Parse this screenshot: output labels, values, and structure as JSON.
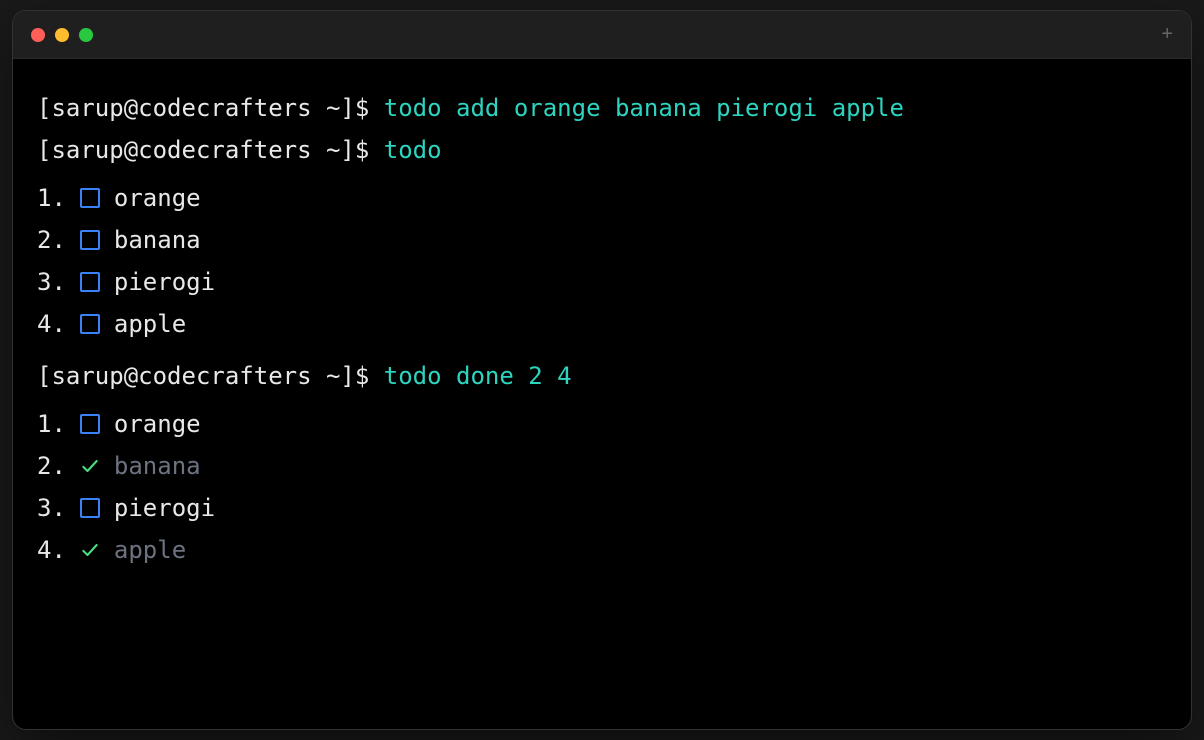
{
  "prompt": "[sarup@codecrafters ~]$ ",
  "commands": {
    "cmd1": "todo add orange banana pierogi apple",
    "cmd2": "todo",
    "cmd3": "todo done 2 4"
  },
  "list1": [
    {
      "num": "1.",
      "text": "orange",
      "done": false
    },
    {
      "num": "2.",
      "text": "banana",
      "done": false
    },
    {
      "num": "3.",
      "text": "pierogi",
      "done": false
    },
    {
      "num": "4.",
      "text": "apple",
      "done": false
    }
  ],
  "list2": [
    {
      "num": "1.",
      "text": "orange",
      "done": false
    },
    {
      "num": "2.",
      "text": "banana",
      "done": true
    },
    {
      "num": "3.",
      "text": "pierogi",
      "done": false
    },
    {
      "num": "4.",
      "text": "apple",
      "done": true
    }
  ],
  "newTabLabel": "+"
}
